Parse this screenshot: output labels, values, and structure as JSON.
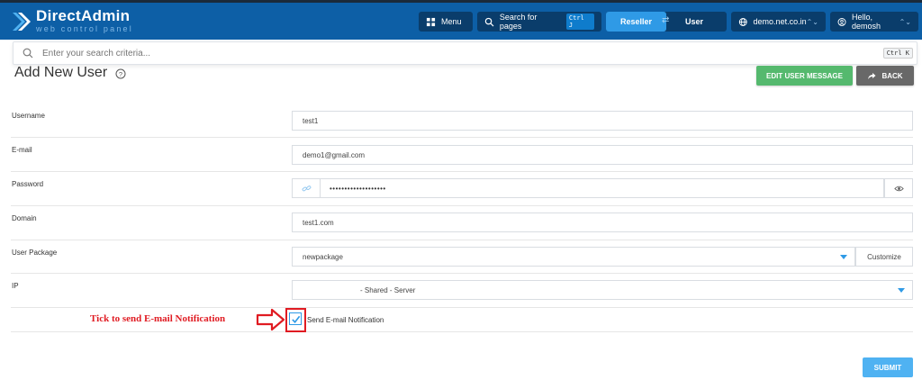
{
  "brand": {
    "name": "DirectAdmin",
    "tagline": "web control panel"
  },
  "topbar": {
    "menu_label": "Menu",
    "search_label": "Search for pages",
    "search_shortcut": "Ctrl J",
    "role_reseller": "Reseller",
    "role_user": "User",
    "domain": "demo.net.co.in",
    "greeting": "Hello, demosh"
  },
  "search": {
    "placeholder": "Enter your search criteria...",
    "shortcut": "Ctrl K"
  },
  "page": {
    "title": "Add New User",
    "edit_message_button": "EDIT USER MESSAGE",
    "back_button": "BACK"
  },
  "form": {
    "username": {
      "label": "Username",
      "value": "test1"
    },
    "email": {
      "label": "E-mail",
      "value": "demo1@gmail.com"
    },
    "password": {
      "label": "Password",
      "value": "•••••••••••••••••••"
    },
    "domain": {
      "label": "Domain",
      "value": "test1.com"
    },
    "package": {
      "label": "User Package",
      "value": "newpackage",
      "customize": "Customize"
    },
    "ip": {
      "label": "IP",
      "value": "- Shared - Server"
    },
    "notify": {
      "label": "Send E-mail Notification",
      "checked": true
    },
    "submit": "SUBMIT"
  },
  "annotation": {
    "text": "Tick to send E-mail Notification",
    "color": "#e01b22"
  },
  "colors": {
    "topbar": "#0d5fa6",
    "accent": "#2f9ae6",
    "green": "#55b96e"
  }
}
